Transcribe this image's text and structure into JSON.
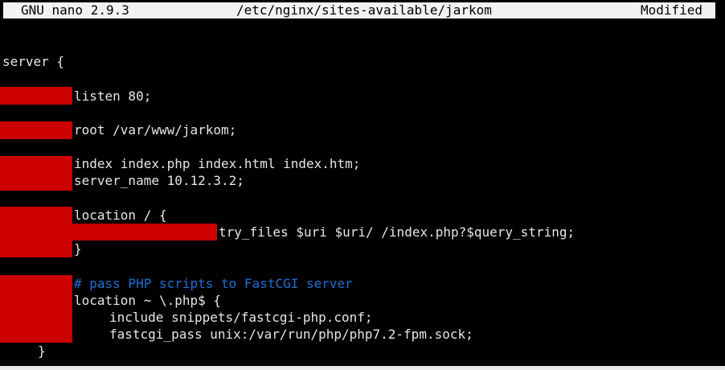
{
  "window": {
    "app_version": "GNU nano 2.9.3",
    "file_path": "/etc/nginx/sites-available/jarkom",
    "status": "Modified"
  },
  "editor": {
    "lines": {
      "l1": "server {",
      "l2": "listen 80;",
      "l3": "root /var/www/jarkom;",
      "l4": "index index.php index.html index.htm;",
      "l5": "server_name 10.12.3.2;",
      "l6": "location / {",
      "l7": "try_files $uri $uri/ /index.php?$query_string;",
      "l8": "}",
      "l9": "# pass PHP scripts to FastCGI server",
      "l10": "location ~ \\.php$ {",
      "l11": "include snippets/fastcgi-php.conf;",
      "l12": "fastcgi_pass unix:/var/run/php/php7.2-fpm.sock;",
      "l13": "}"
    },
    "colors": {
      "background": "#000000",
      "text": "#e6e6e6",
      "comment": "#1f6fd0",
      "redaction": "#cc0000",
      "titlebar": "#f2f2f2"
    }
  }
}
